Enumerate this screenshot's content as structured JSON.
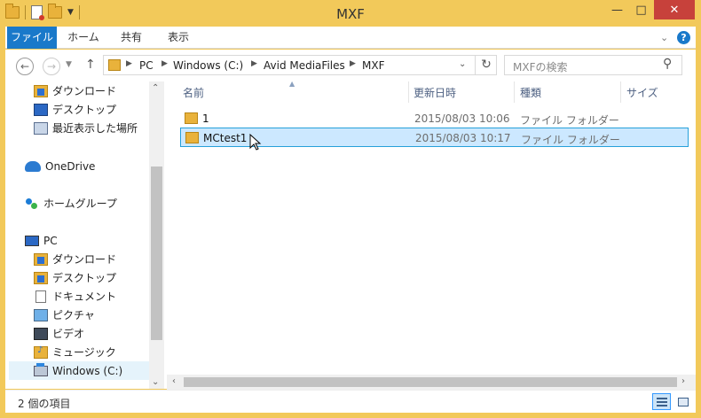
{
  "window": {
    "title": "MXF",
    "controls": {
      "minimize": "—",
      "maximize": "□",
      "close": "✕"
    }
  },
  "ribbon": {
    "tabs": [
      "ファイル",
      "ホーム",
      "共有",
      "表示"
    ],
    "collapse_icon": "chevron-down-icon",
    "help_label": "?"
  },
  "address": {
    "crumbs": [
      "PC",
      "Windows (C:)",
      "Avid MediaFiles",
      "MXF"
    ],
    "search_placeholder": "MXFの検索"
  },
  "nav": {
    "items": [
      {
        "label": "ダウンロード",
        "icon": "download-folder-icon"
      },
      {
        "label": "デスクトップ",
        "icon": "desktop-icon"
      },
      {
        "label": "最近表示した場所",
        "icon": "recent-places-icon"
      },
      {
        "label": "OneDrive",
        "icon": "onedrive-icon"
      },
      {
        "label": "ホームグループ",
        "icon": "homegroup-icon"
      },
      {
        "label": "PC",
        "icon": "pc-icon"
      },
      {
        "label": "ダウンロード",
        "icon": "download-folder-icon"
      },
      {
        "label": "デスクトップ",
        "icon": "desktop-folder-icon"
      },
      {
        "label": "ドキュメント",
        "icon": "documents-icon"
      },
      {
        "label": "ピクチャ",
        "icon": "pictures-icon"
      },
      {
        "label": "ビデオ",
        "icon": "videos-icon"
      },
      {
        "label": "ミュージック",
        "icon": "music-icon"
      },
      {
        "label": "Windows (C:)",
        "icon": "drive-icon"
      }
    ]
  },
  "files": {
    "columns": [
      "名前",
      "更新日時",
      "種類",
      "サイズ"
    ],
    "rows": [
      {
        "name": "1",
        "modified": "2015/08/03 10:06",
        "type": "ファイル フォルダー"
      },
      {
        "name": "MCtest1",
        "modified": "2015/08/03 10:17",
        "type": "ファイル フォルダー"
      }
    ]
  },
  "status": {
    "item_count": "2 個の項目"
  },
  "colors": {
    "title_bar": "#f2c95a",
    "file_tab": "#1979ca",
    "close_button": "#c7413b",
    "selection_fill": "#cce8ff",
    "selection_border": "#26a0da"
  }
}
